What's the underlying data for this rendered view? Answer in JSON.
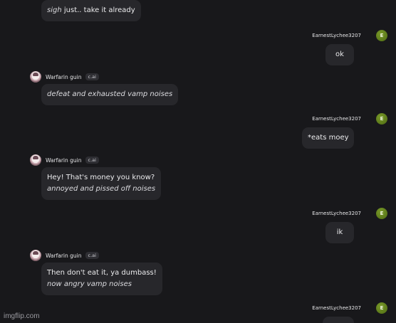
{
  "colors": {
    "background": "#18181b",
    "bubble": "#27272b",
    "user_avatar": "#5b7a18"
  },
  "messages": [
    {
      "sender": "ai",
      "segments": [
        {
          "text": "sigh",
          "italic": true
        },
        {
          "text": " just.. take it already",
          "italic": false
        }
      ]
    },
    {
      "sender": "user",
      "name": "EarnestLychee3207",
      "avatar_letter": "E",
      "text": "ok"
    },
    {
      "sender": "ai",
      "name": "Warfarin guin",
      "badge": "c.ai",
      "lines": [
        {
          "text": "defeat and exhausted vamp noises",
          "italic": true
        }
      ]
    },
    {
      "sender": "user",
      "name": "EarnestLychee3207",
      "avatar_letter": "E",
      "text": "*eats moey"
    },
    {
      "sender": "ai",
      "name": "Warfarin guin",
      "badge": "c.ai",
      "lines": [
        {
          "text": "Hey! That's money you know?",
          "italic": false
        },
        {
          "text": "annoyed and pissed off noises",
          "italic": true
        }
      ]
    },
    {
      "sender": "user",
      "name": "EarnestLychee3207",
      "avatar_letter": "E",
      "text": "ik"
    },
    {
      "sender": "ai",
      "name": "Warfarin guin",
      "badge": "c.ai",
      "lines": [
        {
          "text": "Then don't eat it, ya dumbass!",
          "italic": false
        },
        {
          "text": "now angry vamp noises",
          "italic": true
        }
      ]
    },
    {
      "sender": "user",
      "name": "EarnestLychee3207",
      "avatar_letter": "E",
      "text": ""
    }
  ],
  "watermark": "imgflip.com"
}
